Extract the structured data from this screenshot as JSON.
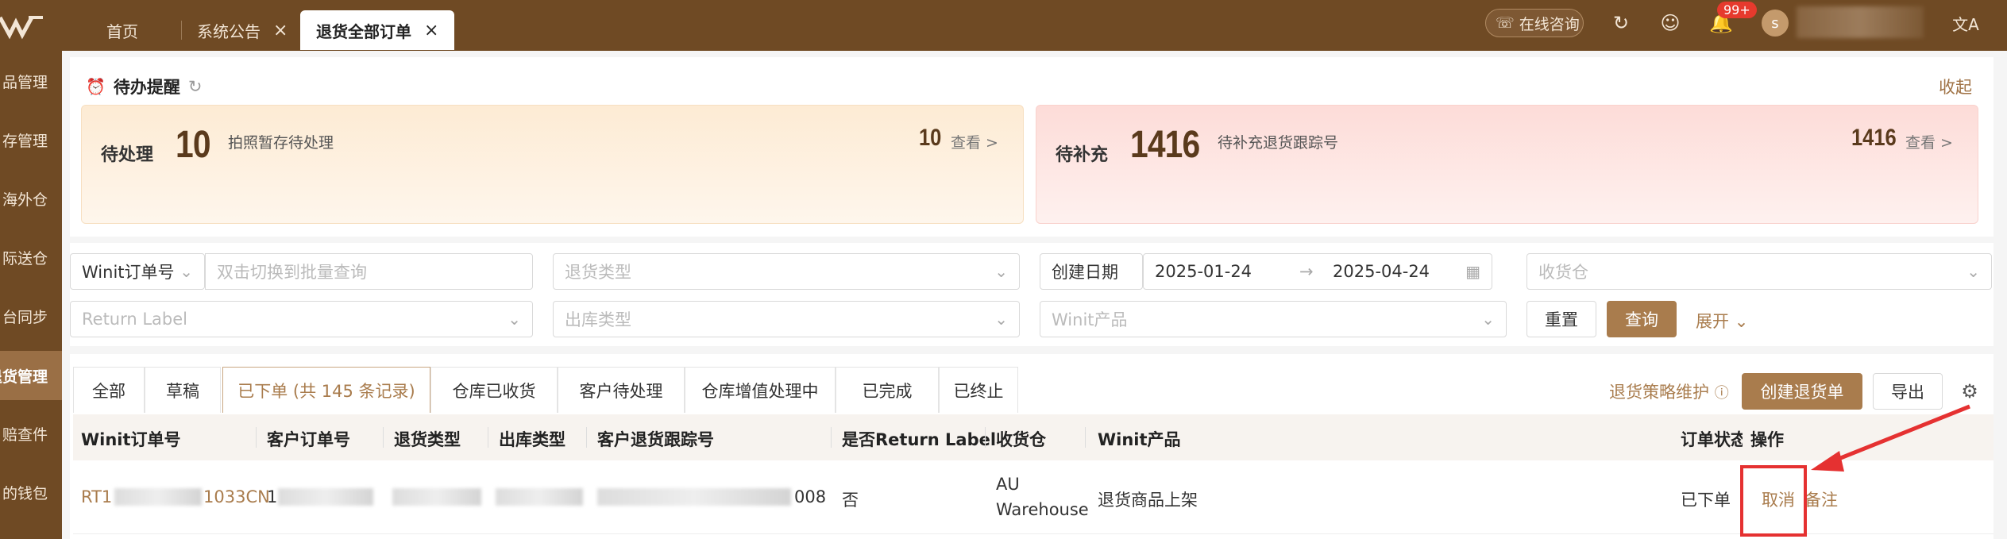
{
  "tabs": [
    {
      "label": "首页"
    },
    {
      "label": "系统公告",
      "close": "×"
    },
    {
      "label": "退货全部订单",
      "close": "×"
    }
  ],
  "topbar": {
    "consult_label": "在线咨询",
    "badge": "99+",
    "avatar_letter": "s",
    "translate_icon": "文A"
  },
  "sidebar": {
    "items": [
      "商品管理",
      "库存管理",
      "海外仓",
      "国际送仓",
      "平台同步",
      "退货管理",
      "索赔查件",
      "我的钱包"
    ],
    "display": [
      "品管理",
      "存管理",
      "海外仓",
      "际送仓",
      "台同步",
      "退货管理",
      "赔查件",
      "的钱包"
    ]
  },
  "todo": {
    "title": "待办提醒",
    "collapse": "收起",
    "cards": [
      {
        "label": "待处理",
        "number": "10",
        "desc": "拍照暂存待处理",
        "count": "10",
        "view": "查看 >"
      },
      {
        "label": "待补充",
        "number": "1416",
        "desc": "待补充退货跟踪号",
        "count": "1416",
        "view": "查看 >"
      }
    ]
  },
  "filters": {
    "order_type_select": "Winit订单号",
    "order_input_placeholder": "双击切换到批量查询",
    "return_type_placeholder": "退货类型",
    "date_label": "创建日期",
    "date_start": "2025-01-24",
    "date_end": "2025-04-24",
    "warehouse_placeholder": "收货仓",
    "return_label_placeholder": "Return Label",
    "outbound_type_placeholder": "出库类型",
    "product_placeholder": "Winit产品",
    "reset": "重置",
    "search": "查询",
    "expand": "展开"
  },
  "status_tabs": [
    {
      "label": "全部"
    },
    {
      "label": "草稿"
    },
    {
      "label": "已下单 (共 145 条记录)",
      "active": true
    },
    {
      "label": "仓库已收货"
    },
    {
      "label": "客户待处理"
    },
    {
      "label": "仓库增值处理中"
    },
    {
      "label": "已完成"
    },
    {
      "label": "已终止"
    }
  ],
  "toolbar": {
    "policy": "退货策略维护",
    "create": "创建退货单",
    "export": "导出"
  },
  "table": {
    "columns": [
      "Winit订单号",
      "客户订单号",
      "退货类型",
      "出库类型",
      "客户退货跟踪号",
      "是否Return Label",
      "收货仓",
      "Winit产品",
      "订单状态",
      "操作"
    ],
    "rows": [
      {
        "winit_order_prefix": "RT1",
        "winit_order_suffix": "1033CN",
        "customer_order_prefix": "1",
        "tracking_suffix": "008",
        "return_label": "否",
        "warehouse_line1": "AU",
        "warehouse_line2": "Warehouse",
        "product": "退货商品上架",
        "status": "已下单",
        "action_cancel": "取消",
        "action_note": "备注"
      }
    ]
  },
  "colors": {
    "brand": "#6f4a24",
    "accent": "#a97c4d",
    "highlight": "#e53131"
  }
}
